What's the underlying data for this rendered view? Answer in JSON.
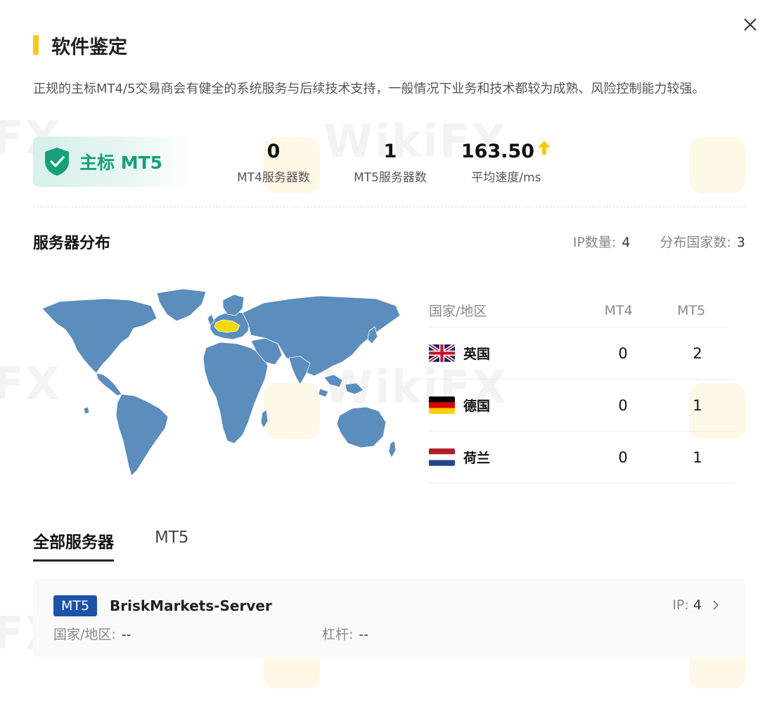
{
  "dialog": {
    "title": "软件鉴定",
    "description": "正规的主标MT4/5交易商会有健全的系统服务与后续技术支持，一般情况下业务和技术都较为成熟、风险控制能力较强。"
  },
  "badge": {
    "label": "主标 MT5",
    "icon": "shield-check-icon",
    "color": "#16a07a"
  },
  "stats": [
    {
      "value": "0",
      "label": "MT4服务器数"
    },
    {
      "value": "1",
      "label": "MT5服务器数"
    },
    {
      "value": "163.50",
      "label": "平均速度/ms",
      "icon": "arrow-up-icon"
    }
  ],
  "distribution": {
    "title": "服务器分布",
    "ip_label": "IP数量:",
    "ip_count": "4",
    "country_label": "分布国家数:",
    "country_count": "3",
    "table": {
      "headers": [
        "国家/地区",
        "MT4",
        "MT5"
      ],
      "rows": [
        {
          "flag": "uk-flag-icon",
          "country": "英国",
          "mt4": "0",
          "mt5": "2"
        },
        {
          "flag": "germany-flag-icon",
          "country": "德国",
          "mt4": "0",
          "mt5": "1"
        },
        {
          "flag": "netherlands-flag-icon",
          "country": "荷兰",
          "mt4": "0",
          "mt5": "1"
        }
      ]
    }
  },
  "tabs": [
    {
      "label": "全部服务器",
      "active": true
    },
    {
      "label": "MT5",
      "active": false
    }
  ],
  "server": {
    "tag": "MT5",
    "name": "BriskMarkets-Server",
    "ip_label": "IP:",
    "ip_count": "4",
    "country_label": "国家/地区:",
    "country_value": "--",
    "leverage_label": "杠杆:",
    "leverage_value": "--"
  },
  "colors": {
    "accent": "#f7c91b",
    "map_land": "#5b8dbd",
    "map_highlight": "#f5d90a",
    "tag_blue": "#1c52a7"
  },
  "watermark": "WikiFX"
}
